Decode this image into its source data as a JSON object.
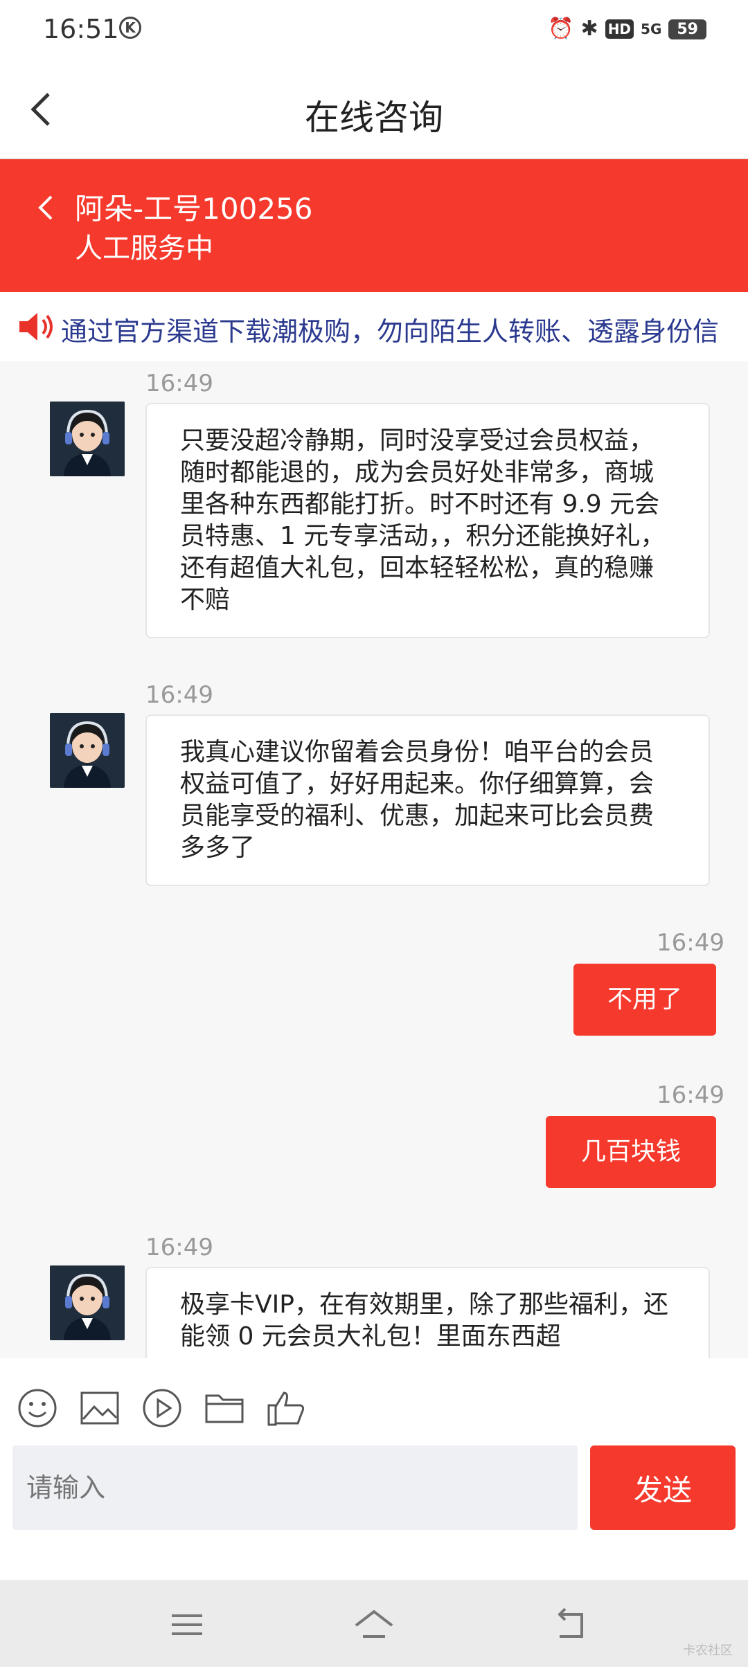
{
  "status_bar": {
    "time": "16:51",
    "k_badge": "K",
    "hd": "HD",
    "net": "5G",
    "battery": "59"
  },
  "header": {
    "title": "在线咨询"
  },
  "agent": {
    "name": "阿朵-工号100256",
    "status": "人工服务中"
  },
  "notice": {
    "text": "通过官方渠道下载潮极购，勿向陌生人转账、透露身份信"
  },
  "messages": [
    {
      "from": "agent",
      "time": "16:49",
      "text": "只要没超冷静期，同时没享受过会员权益，随时都能退的，成为会员好处非常多，商城里各种东西都能打折。时不时还有 9.9 元会员特惠、1 元专享活动，，积分还能换好礼，还有超值大礼包，回本轻轻松松，真的稳赚不赔"
    },
    {
      "from": "agent",
      "time": "16:49",
      "text": "我真心建议你留着会员身份！咱平台的会员权益可值了，好好用起来。你仔细算算，会员能享受的福利、优惠，加起来可比会员费多多了"
    },
    {
      "from": "user",
      "time": "16:49",
      "text": "不用了"
    },
    {
      "from": "user",
      "time": "16:49",
      "text": "几百块钱"
    },
    {
      "from": "agent",
      "time": "16:49",
      "text": "极享卡VIP，在有效期里，除了那些福利，还能领 0 元会员大礼包！里面东西超"
    }
  ],
  "input": {
    "placeholder": "请输入",
    "send_label": "发送"
  },
  "watermark": "卡农社区",
  "colors": {
    "accent": "#f5392c",
    "notice_text": "#2b3a8f"
  }
}
